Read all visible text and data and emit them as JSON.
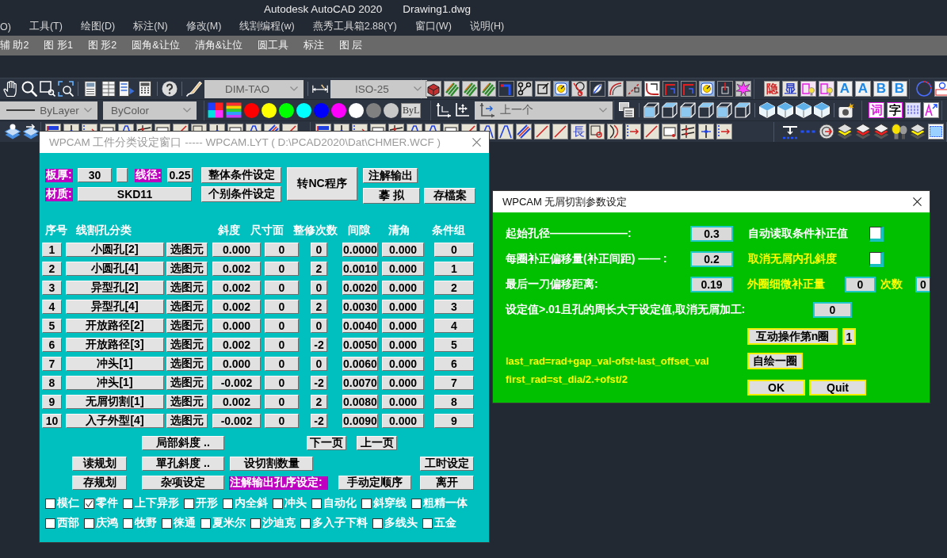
{
  "app_window": {
    "title": "Autodesk AutoCAD 2020",
    "document": "Drawing1.dwg"
  },
  "menu_bar": [
    "O)",
    "工具(T)",
    "绘图(D)",
    "标注(N)",
    "修改(M)",
    "线割编程(w)",
    "燕秀工具箱2.88(Y)",
    "窗口(W)",
    "说明(H)"
  ],
  "custom_menu": [
    "辅 助2",
    "图 形1",
    "图 形2",
    "圆角&让位",
    "清角&让位",
    "圆工具",
    "标注",
    "图 层"
  ],
  "toolbars": {
    "text_style": "DIM-TAO",
    "dimension_style": "ISO-25",
    "linetype": "ByLayer",
    "plot_style": "ByColor",
    "color_swatches": [
      {
        "color": "#ff0000"
      },
      {
        "color": "#ffff00"
      },
      {
        "color": "#00ff00"
      },
      {
        "color": "#00ffff"
      },
      {
        "color": "#0000ff"
      },
      {
        "color": "#ff00ff"
      },
      {
        "color": "#ffffff"
      },
      {
        "color": "#808080"
      },
      {
        "color": "#c8c8c8"
      }
    ],
    "bylayer_button": "ByL",
    "named_view": "上一个",
    "glyph_buttons": [
      {
        "glyph": "隐",
        "color": "#d02828"
      },
      {
        "glyph": "显",
        "color": "#2a3ec8"
      }
    ],
    "letter_buttons": [
      "A",
      "A",
      "B",
      "B"
    ],
    "text_buttons": [
      {
        "glyph": "词",
        "color": "#e020e0"
      },
      {
        "glyph": "字",
        "color": "#000000"
      }
    ],
    "row3_glyph": "長"
  },
  "classification_dialog": {
    "title": "WPCAM 工件分类设定窗口 ----- WPCAM.LYT ( D:\\PCAD2020\\Dat\\CHMER.WCF )",
    "thickness": {
      "label": "板厚:",
      "value": "30"
    },
    "wire_diameter": {
      "label": "线径:",
      "value": "0.25"
    },
    "material": {
      "label": "材质:",
      "value": "SKD11"
    },
    "buttons": {
      "global_conditions": "整体条件设定",
      "individual_conditions": "个别条件设定",
      "to_nc": "转NC程序",
      "annotation_output": "注解输出",
      "simulate": "摹 拟",
      "save_file": "存檔案"
    },
    "columns": [
      "序号",
      "线割孔分类",
      "斜度",
      "尺寸面",
      "整修次数",
      "间隙",
      "清角",
      "条件组"
    ],
    "rows": [
      {
        "no": "1",
        "type": "小圆孔[2]",
        "pick": "选图元",
        "slope": "0.000",
        "size_face": "0",
        "trim_count": "0",
        "gap": "0.0000",
        "corner": "0.000",
        "condition_group": "0"
      },
      {
        "no": "2",
        "type": "小圆孔[4]",
        "pick": "选图元",
        "slope": "0.002",
        "size_face": "0",
        "trim_count": "2",
        "gap": "0.0010",
        "corner": "0.000",
        "condition_group": "1"
      },
      {
        "no": "3",
        "type": "异型孔[2]",
        "pick": "选图元",
        "slope": "0.002",
        "size_face": "0",
        "trim_count": "0",
        "gap": "0.0020",
        "corner": "0.000",
        "condition_group": "2"
      },
      {
        "no": "4",
        "type": "异型孔[4]",
        "pick": "选图元",
        "slope": "0.002",
        "size_face": "0",
        "trim_count": "2",
        "gap": "0.0030",
        "corner": "0.000",
        "condition_group": "3"
      },
      {
        "no": "5",
        "type": "开放路径[2]",
        "pick": "选图元",
        "slope": "0.000",
        "size_face": "0",
        "trim_count": "0",
        "gap": "0.0040",
        "corner": "0.000",
        "condition_group": "4"
      },
      {
        "no": "6",
        "type": "开放路径[3]",
        "pick": "选图元",
        "slope": "0.002",
        "size_face": "0",
        "trim_count": "-2",
        "gap": "0.0050",
        "corner": "0.000",
        "condition_group": "5"
      },
      {
        "no": "7",
        "type": "冲头[1]",
        "pick": "选图元",
        "slope": "0.000",
        "size_face": "0",
        "trim_count": "0",
        "gap": "0.0060",
        "corner": "0.000",
        "condition_group": "6"
      },
      {
        "no": "8",
        "type": "冲头[1]",
        "pick": "选图元",
        "slope": "-0.002",
        "size_face": "0",
        "trim_count": "-2",
        "gap": "0.0070",
        "corner": "0.000",
        "condition_group": "7"
      },
      {
        "no": "9",
        "type": "无屑切割[1]",
        "pick": "选图元",
        "slope": "0.002",
        "size_face": "0",
        "trim_count": "2",
        "gap": "0.0080",
        "corner": "0.000",
        "condition_group": "8"
      },
      {
        "no": "10",
        "type": "入子外型[4]",
        "pick": "选图元",
        "slope": "-0.002",
        "size_face": "0",
        "trim_count": "-2",
        "gap": "0.0090",
        "corner": "0.000",
        "condition_group": "9"
      }
    ],
    "bottom": {
      "partial_slope": "局部斜度 ..",
      "next_page": "下一页",
      "prev_page": "上一页",
      "read_plan": "读规划",
      "single_hole_slope": "單孔斜度 ..",
      "set_cut_count": "设切割数量",
      "work_hours": "工时设定",
      "save_plan": "存规划",
      "misc_settings": "杂项设定",
      "order_label": "注解输出孔序设定:",
      "manual_order": "手动定顺序",
      "exit": "离开"
    },
    "option_rows": [
      {
        "items": [
          {
            "label": "模仁",
            "checked": false
          },
          {
            "label": "零件",
            "checked": true
          },
          {
            "label": "上下异形",
            "checked": false
          },
          {
            "label": "开形",
            "checked": false
          },
          {
            "label": "内全斜",
            "checked": false
          },
          {
            "label": "冲头",
            "checked": false
          },
          {
            "label": "自动化",
            "checked": false
          },
          {
            "label": "斜穿线",
            "checked": false
          },
          {
            "label": "粗精一体",
            "checked": false
          }
        ]
      },
      {
        "items": [
          {
            "label": "西部",
            "checked": false
          },
          {
            "label": "庆鸿",
            "checked": false
          },
          {
            "label": "牧野",
            "checked": false
          },
          {
            "label": "徕通",
            "checked": false
          },
          {
            "label": "夏米尔",
            "checked": false
          },
          {
            "label": "沙迪克",
            "checked": false
          },
          {
            "label": "多入子下料",
            "checked": false
          },
          {
            "label": "多线头",
            "checked": false
          },
          {
            "label": "五金",
            "checked": false
          }
        ]
      }
    ]
  },
  "no_core_cut_dialog": {
    "title": "WPCAM 无屑切割参数设定",
    "start_hole_diameter": {
      "label": "起始孔径———————:",
      "value": "0.3"
    },
    "auto_read_conditions": {
      "label": "自动读取条件补正值",
      "checked": false
    },
    "offset_per_loop": {
      "label": "每圈补正偏移量(补正间距) —— :",
      "value": "0.2"
    },
    "cancel_inner_slope": {
      "label": "取消无屑内孔斜度",
      "checked": false
    },
    "last_cut_offset": {
      "label": "最后一刀偏移距离:",
      "value": "0.19"
    },
    "outer_fine_offset": {
      "label": "外圈细微补正量",
      "value": "0"
    },
    "repeat_count": {
      "label": "次数",
      "value": "0"
    },
    "perimeter_limit": {
      "label": "设定值>.01且孔的周长大于设定值,取消无屑加工:",
      "value": "0"
    },
    "interactive_loop": {
      "button": "互动操作第n圈",
      "value": "1"
    },
    "formulas": [
      "last_rad=rad+gap_val-ofst-last_offset_val",
      "first_rad=st_dia/2.+ofst/2"
    ],
    "draw_loop_button": "自绘一圈",
    "ok_button": "OK",
    "quit_button": "Quit"
  }
}
